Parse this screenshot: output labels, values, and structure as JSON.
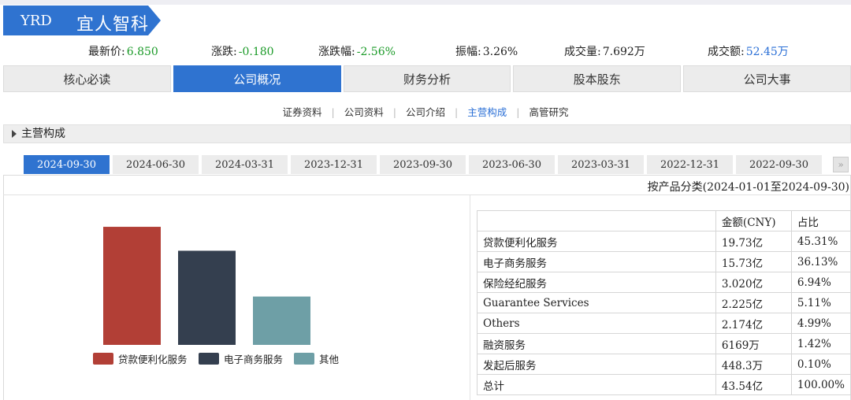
{
  "header": {
    "code": "YRD",
    "name": "宜人智科",
    "accent": "#2f73d0"
  },
  "quote": [
    {
      "label": "最新价:",
      "value": "6.850",
      "color": "#1a9a27"
    },
    {
      "label": "涨跌:",
      "value": "-0.180",
      "color": "#1a9a27"
    },
    {
      "label": "涨跌幅:",
      "value": "-2.56%",
      "color": "#1a9a27"
    },
    {
      "label": "振幅:",
      "value": "3.26%",
      "color": "#222222"
    },
    {
      "label": "成交量:",
      "value": "7.692万",
      "color": "#222222"
    },
    {
      "label": "成交额:",
      "value": "52.45万",
      "color": "#2a6fd6"
    }
  ],
  "tabs": [
    "核心必读",
    "公司概况",
    "财务分析",
    "股本股东",
    "公司大事"
  ],
  "active_tab": 1,
  "subnav": [
    "证券资料",
    "公司资料",
    "公司介绍",
    "主营构成",
    "高管研究"
  ],
  "active_subnav": 3,
  "section_title": "主营构成",
  "dates": [
    "2024-09-30",
    "2024-06-30",
    "2024-03-31",
    "2023-12-31",
    "2023-09-30",
    "2023-06-30",
    "2023-03-31",
    "2022-12-31",
    "2022-09-30"
  ],
  "active_date": 0,
  "more_icon": "double-chevron-right-icon",
  "more_glyph": "»",
  "classification": "按产品分类(2024-01-01至2024-09-30)",
  "chart_data": {
    "type": "bar",
    "categories": [
      "贷款便利化服务",
      "电子商务服务",
      "其他"
    ],
    "values": [
      19.73,
      15.73,
      8.08
    ],
    "colors": [
      "#b23f36",
      "#343f4f",
      "#6e9fa6"
    ],
    "ylim": [
      0,
      20
    ],
    "legend": "bottom",
    "grid": false
  },
  "table": {
    "headers": [
      "",
      "金额(CNY)",
      "占比"
    ],
    "rows": [
      [
        "贷款便利化服务",
        "19.73亿",
        "45.31%"
      ],
      [
        "电子商务服务",
        "15.73亿",
        "36.13%"
      ],
      [
        "保险经纪服务",
        "3.020亿",
        "6.94%"
      ],
      [
        "Guarantee Services",
        "2.225亿",
        "5.11%"
      ],
      [
        "Others",
        "2.174亿",
        "4.99%"
      ],
      [
        "融资服务",
        "6169万",
        "1.42%"
      ],
      [
        "发起后服务",
        "448.3万",
        "0.10%"
      ],
      [
        "总计",
        "43.54亿",
        "100.00%"
      ]
    ]
  }
}
